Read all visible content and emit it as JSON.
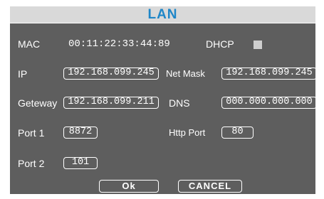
{
  "window": {
    "title": "LAN"
  },
  "mac": {
    "label": "MAC",
    "value": "00:11:22:33:44:89"
  },
  "dhcp": {
    "label": "DHCP",
    "checked": false
  },
  "ip": {
    "label": "IP",
    "value": "192.168.099.245"
  },
  "netmask": {
    "label": "Net Mask",
    "value": "192.168.099.245"
  },
  "gateway": {
    "label": "Geteway",
    "value": "192.168.099.211"
  },
  "dns": {
    "label": "DNS",
    "value": "000.000.000.000"
  },
  "port1": {
    "label": "Port 1",
    "value": "8872"
  },
  "http_port": {
    "label": "Http Port",
    "value": "80"
  },
  "port2": {
    "label": "Port 2",
    "value": "101"
  },
  "buttons": {
    "ok": "Ok",
    "cancel": "CANCEL"
  },
  "colors": {
    "title_text": "#1e86c8",
    "title_bg": "#d9d9d9",
    "panel_bg": "#5e5e5e",
    "field_border": "#ffffff",
    "checkbox": "#cfcfcf"
  }
}
